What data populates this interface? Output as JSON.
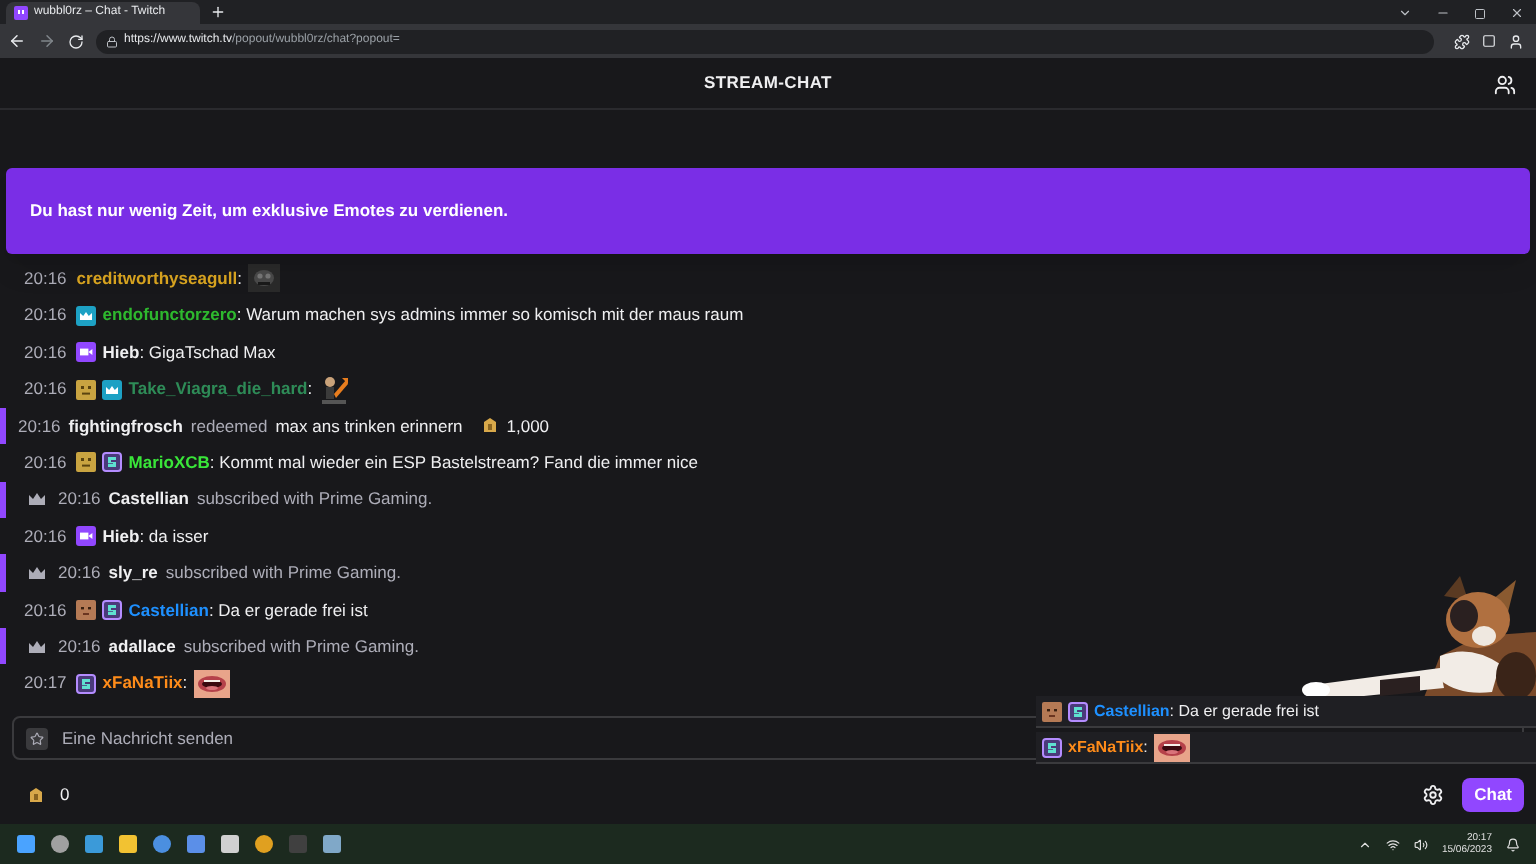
{
  "browser": {
    "tab_title": "wubbl0rz – Chat - Twitch",
    "url_host": "https://www.twitch.tv",
    "url_path": "/popout/wubbl0rz/chat?popout="
  },
  "header": {
    "title": "STREAM-CHAT"
  },
  "banner": {
    "text": "Du hast nur wenig Zeit, um exklusive Emotes zu verdienen."
  },
  "messages": [
    {
      "kind": "chat",
      "time": "20:16",
      "user": "creditworthyseagull",
      "color": "#daa520",
      "text": ":",
      "emote": {
        "kind": "picture"
      }
    },
    {
      "kind": "chat",
      "time": "20:16",
      "badges": [
        {
          "kind": "crown"
        }
      ],
      "user": "endofunctorzero",
      "color": "#2eb82e",
      "text": ": Warum machen sys admins immer so komisch mit der maus raum"
    },
    {
      "kind": "chat",
      "time": "20:16",
      "badges": [
        {
          "kind": "camera"
        }
      ],
      "user": "Hieb",
      "color": "#efeff1",
      "text": ": GigaTschad Max"
    },
    {
      "kind": "chat",
      "time": "20:16",
      "badges": [
        {
          "kind": "gold"
        },
        {
          "kind": "crown"
        }
      ],
      "user": "Take_Viagra_die_hard",
      "color": "#2e8b57",
      "text": ":",
      "emote": {
        "kind": "picture"
      }
    },
    {
      "kind": "redeem",
      "time": "20:16",
      "user": "fightingfrosch",
      "action": "redeemed",
      "reward": "max ans trinken erinnern",
      "cost": "1,000"
    },
    {
      "kind": "chat",
      "time": "20:16",
      "badges": [
        {
          "kind": "gold"
        },
        {
          "kind": "tier"
        }
      ],
      "user": "MarioXCB",
      "color": "#39e639",
      "text": ": Kommt mal wieder ein ESP Bastelstream? Fand die immer nice"
    },
    {
      "kind": "sub",
      "time": "20:16",
      "user": "Castellian",
      "action": "subscribed with Prime Gaming."
    },
    {
      "kind": "chat",
      "time": "20:16",
      "badges": [
        {
          "kind": "camera"
        }
      ],
      "user": "Hieb",
      "color": "#efeff1",
      "text": ": da isser"
    },
    {
      "kind": "sub",
      "time": "20:16",
      "user": "sly_re",
      "action": "subscribed with Prime Gaming."
    },
    {
      "kind": "chat",
      "time": "20:16",
      "badges": [
        {
          "kind": "face"
        },
        {
          "kind": "tier"
        }
      ],
      "user": "Castellian",
      "color": "#1e90ff",
      "text": ": Da er gerade frei ist"
    },
    {
      "kind": "sub",
      "time": "20:16",
      "user": "adallace",
      "action": "subscribed with Prime Gaming."
    },
    {
      "kind": "chat",
      "time": "20:17",
      "badges": [
        {
          "kind": "tier"
        }
      ],
      "user": "xFaNaTiix",
      "color": "#ff8c1a",
      "text": ":",
      "emote": {
        "kind": "picture"
      }
    }
  ],
  "overlay": {
    "messages": [
      {
        "badges": [
          {
            "kind": "face"
          },
          {
            "kind": "tier"
          }
        ],
        "user": "Castellian",
        "color": "#1e90ff",
        "text": ": Da er gerade frei ist"
      },
      {
        "badges": [
          {
            "kind": "tier"
          }
        ],
        "user": "xFaNaTiix",
        "color": "#ff8c1a",
        "text": ":",
        "emote": {
          "kind": "picture"
        }
      }
    ]
  },
  "input": {
    "placeholder": "Eine Nachricht senden"
  },
  "footer": {
    "points": "0",
    "send_button": "Chat"
  },
  "taskbar": {
    "time": "20:17",
    "date": "15/06/2023"
  }
}
